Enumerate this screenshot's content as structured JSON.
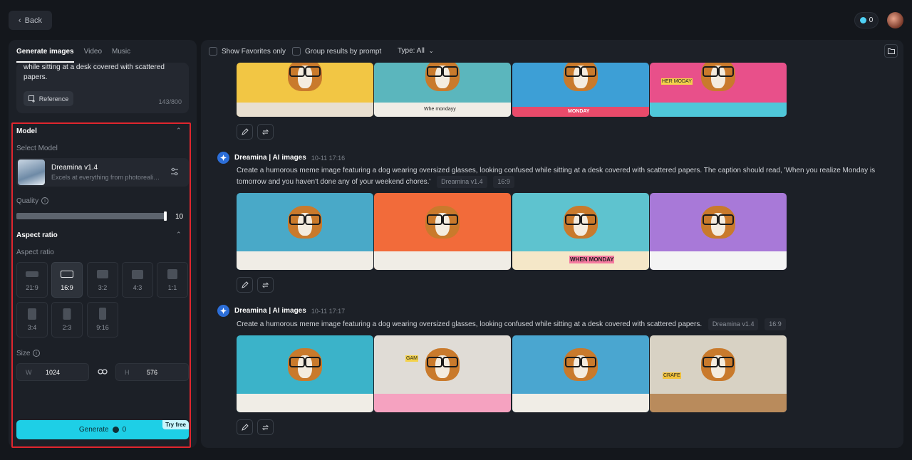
{
  "header": {
    "back_label": "Back",
    "credits": "0"
  },
  "left_panel": {
    "tabs": [
      {
        "label": "Generate images",
        "active": true
      },
      {
        "label": "Video",
        "active": false
      },
      {
        "label": "Music",
        "active": false
      }
    ],
    "prompt_text": "while sitting at a desk covered with scattered papers.",
    "reference_label": "Reference",
    "char_count": "143/800",
    "model_section_title": "Model",
    "select_model_label": "Select Model",
    "model_name": "Dreamina v1.4",
    "model_desc": "Excels at everything from photorealism to painterly styles",
    "quality_label": "Quality",
    "quality_value": "10",
    "quality_level": 1.0,
    "aspect_section_title": "Aspect ratio",
    "aspect_label": "Aspect ratio",
    "ratios": [
      "21:9",
      "16:9",
      "3:2",
      "4:3",
      "1:1",
      "3:4",
      "2:3",
      "9:16"
    ],
    "selected_ratio": "16:9",
    "size_label": "Size",
    "width_prefix": "W",
    "width_value": "1024",
    "height_prefix": "H",
    "height_value": "576",
    "generate_label": "Generate",
    "generate_cost": "0",
    "try_free_label": "Try free"
  },
  "right_panel": {
    "filters": {
      "favorites_label": "Show Favorites only",
      "group_label": "Group results by prompt",
      "type_label": "Type: All"
    },
    "generations": [
      {
        "source": "Dreamina | AI images",
        "time": "10-11  17:16",
        "prompt": "Create a humorous meme image featuring a dog wearing oversized glasses, looking confused while sitting at a desk covered with scattered papers. The caption should read, 'When you realize Monday is tomorrow and you haven't done any of your weekend chores.'",
        "model_tag": "Dreamina v1.4",
        "ratio_tag": "16:9"
      },
      {
        "source": "Dreamina | AI images",
        "time": "10-11  17:17",
        "prompt": "Create a humorous meme image featuring a dog wearing oversized glasses, looking confused while sitting at a desk covered with scattered papers.",
        "model_tag": "Dreamina v1.4",
        "ratio_tag": "16:9"
      }
    ],
    "image_captions": {
      "row0": [
        "",
        "Whe mondayy",
        "MONDAY",
        "HER MODAY"
      ],
      "row1": [
        "",
        "",
        "WHEN MONDAY",
        ""
      ],
      "row2": [
        "",
        "GAM",
        "",
        "CRAFE"
      ]
    }
  },
  "colors": {
    "accent": "#1ecfe6",
    "highlight_border": "#e0262e",
    "panel_bg": "#1c2027",
    "page_bg": "#14171c"
  }
}
